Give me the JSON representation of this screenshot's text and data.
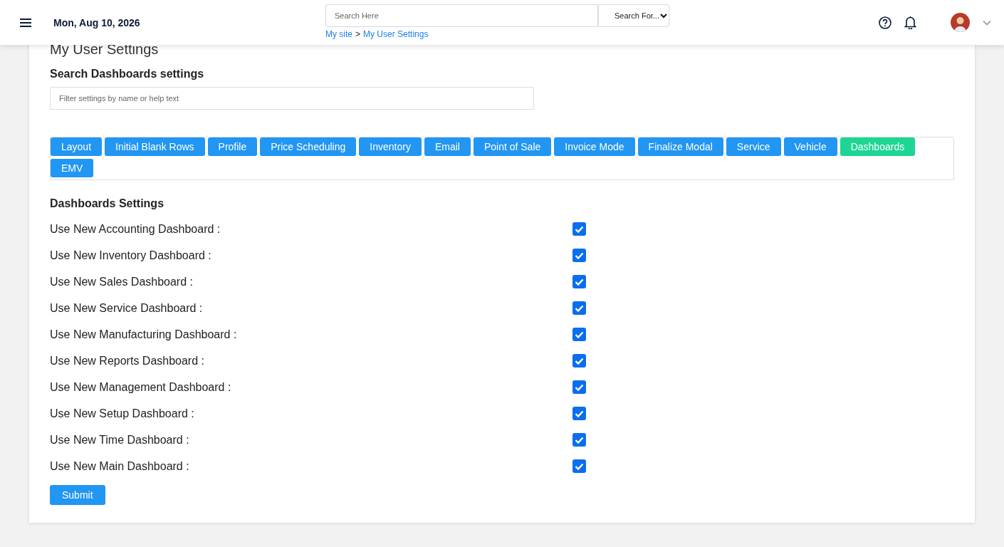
{
  "header": {
    "date": "Mon, Aug 10, 2026",
    "search": {
      "placeholder": "Search Here"
    },
    "search_select": "Search For...",
    "breadcrumb": [
      "My site",
      "My User Settings"
    ],
    "breadcrumb_separator": ">"
  },
  "page_title": "My User Settings",
  "filter": {
    "heading": "Search Dashboards settings",
    "placeholder": "Filter settings by name or help text"
  },
  "tabs": [
    {
      "label": "Layout",
      "selected": false
    },
    {
      "label": "Initial Blank Rows",
      "selected": false
    },
    {
      "label": "Profile",
      "selected": false
    },
    {
      "label": "Price Scheduling",
      "selected": false
    },
    {
      "label": "Inventory",
      "selected": false
    },
    {
      "label": "Email",
      "selected": false
    },
    {
      "label": "Point of Sale",
      "selected": false
    },
    {
      "label": "Invoice Mode",
      "selected": false
    },
    {
      "label": "Finalize Modal",
      "selected": false
    },
    {
      "label": "Service",
      "selected": false
    },
    {
      "label": "Vehicle",
      "selected": false
    },
    {
      "label": "Dashboards",
      "selected": true
    },
    {
      "label": "EMV",
      "selected": false
    }
  ],
  "section_title": "Dashboards Settings",
  "settings": [
    {
      "label": "Use New Accounting Dashboard :",
      "checked": true
    },
    {
      "label": "Use New Inventory Dashboard :",
      "checked": true
    },
    {
      "label": "Use New Sales Dashboard :",
      "checked": true
    },
    {
      "label": "Use New Service Dashboard :",
      "checked": true
    },
    {
      "label": "Use New Manufacturing Dashboard :",
      "checked": true
    },
    {
      "label": "Use New Reports Dashboard :",
      "checked": true
    },
    {
      "label": "Use New Management Dashboard :",
      "checked": true
    },
    {
      "label": "Use New Setup Dashboard :",
      "checked": true
    },
    {
      "label": "Use New Time Dashboard :",
      "checked": true
    },
    {
      "label": "Use New Main Dashboard :",
      "checked": true
    }
  ],
  "submit": "Submit"
}
